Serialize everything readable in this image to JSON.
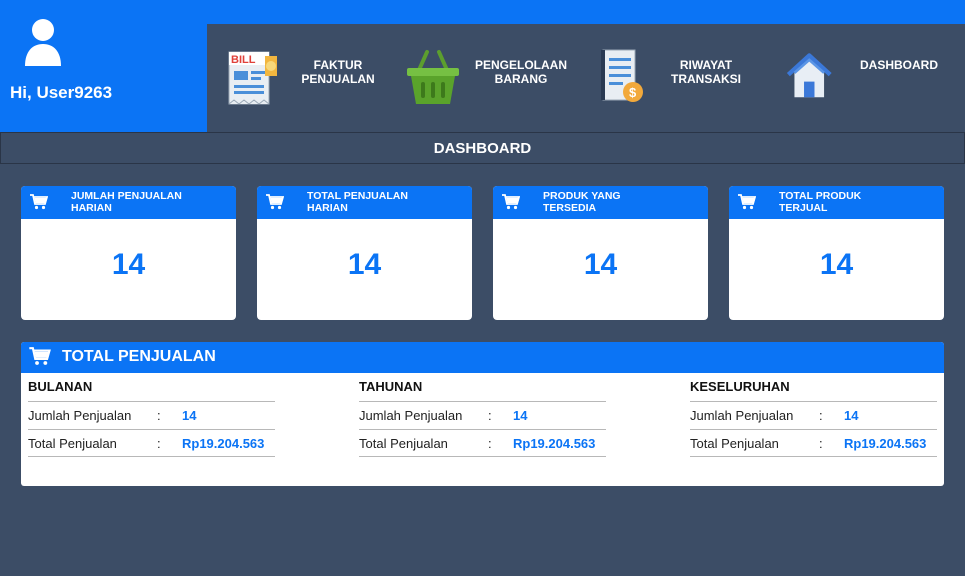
{
  "user": {
    "greeting": "Hi, User9263",
    "avatar_icon": "user-icon"
  },
  "nav": [
    {
      "label": "FAKTUR\nPENJUALAN",
      "icon": "bill-icon"
    },
    {
      "label": "PENGELOLAAN\nBARANG",
      "icon": "basket-icon"
    },
    {
      "label": "RIWAYAT\nTRANSAKSI",
      "icon": "receipt-icon"
    },
    {
      "label": "DASHBOARD",
      "icon": "home-icon"
    }
  ],
  "page_title": "DASHBOARD",
  "cards": [
    {
      "title": "JUMLAH PENJUALAN\nHARIAN",
      "value": "14",
      "icon": "cart-icon"
    },
    {
      "title": "TOTAL PENJUALAN\nHARIAN",
      "value": "14",
      "icon": "cart-icon"
    },
    {
      "title": "PRODUK YANG\nTERSEDIA",
      "value": "14",
      "icon": "cart-icon"
    },
    {
      "title": "TOTAL PRODUK\nTERJUAL",
      "value": "14",
      "icon": "cart-icon"
    }
  ],
  "summary": {
    "title": "TOTAL PENJUALAN",
    "icon": "cart-icon",
    "sections": [
      {
        "title": "BULANAN",
        "rows": [
          {
            "label": "Jumlah Penjualan",
            "colon": ":",
            "value": "14"
          },
          {
            "label": "Total Penjualan",
            "colon": ":",
            "value": "Rp19.204.563"
          }
        ]
      },
      {
        "title": "TAHUNAN",
        "rows": [
          {
            "label": "Jumlah Penjualan",
            "colon": ":",
            "value": "14"
          },
          {
            "label": "Total Penjualan",
            "colon": ":",
            "value": "Rp19.204.563"
          }
        ]
      },
      {
        "title": "KESELURUHAN",
        "rows": [
          {
            "label": "Jumlah Penjualan",
            "colon": ":",
            "value": "14"
          },
          {
            "label": "Total Penjualan",
            "colon": ":",
            "value": "Rp19.204.563"
          }
        ]
      }
    ]
  },
  "colors": {
    "accent": "#0b74f5",
    "background": "#3c4d66",
    "value_blue": "#0b74f5"
  }
}
